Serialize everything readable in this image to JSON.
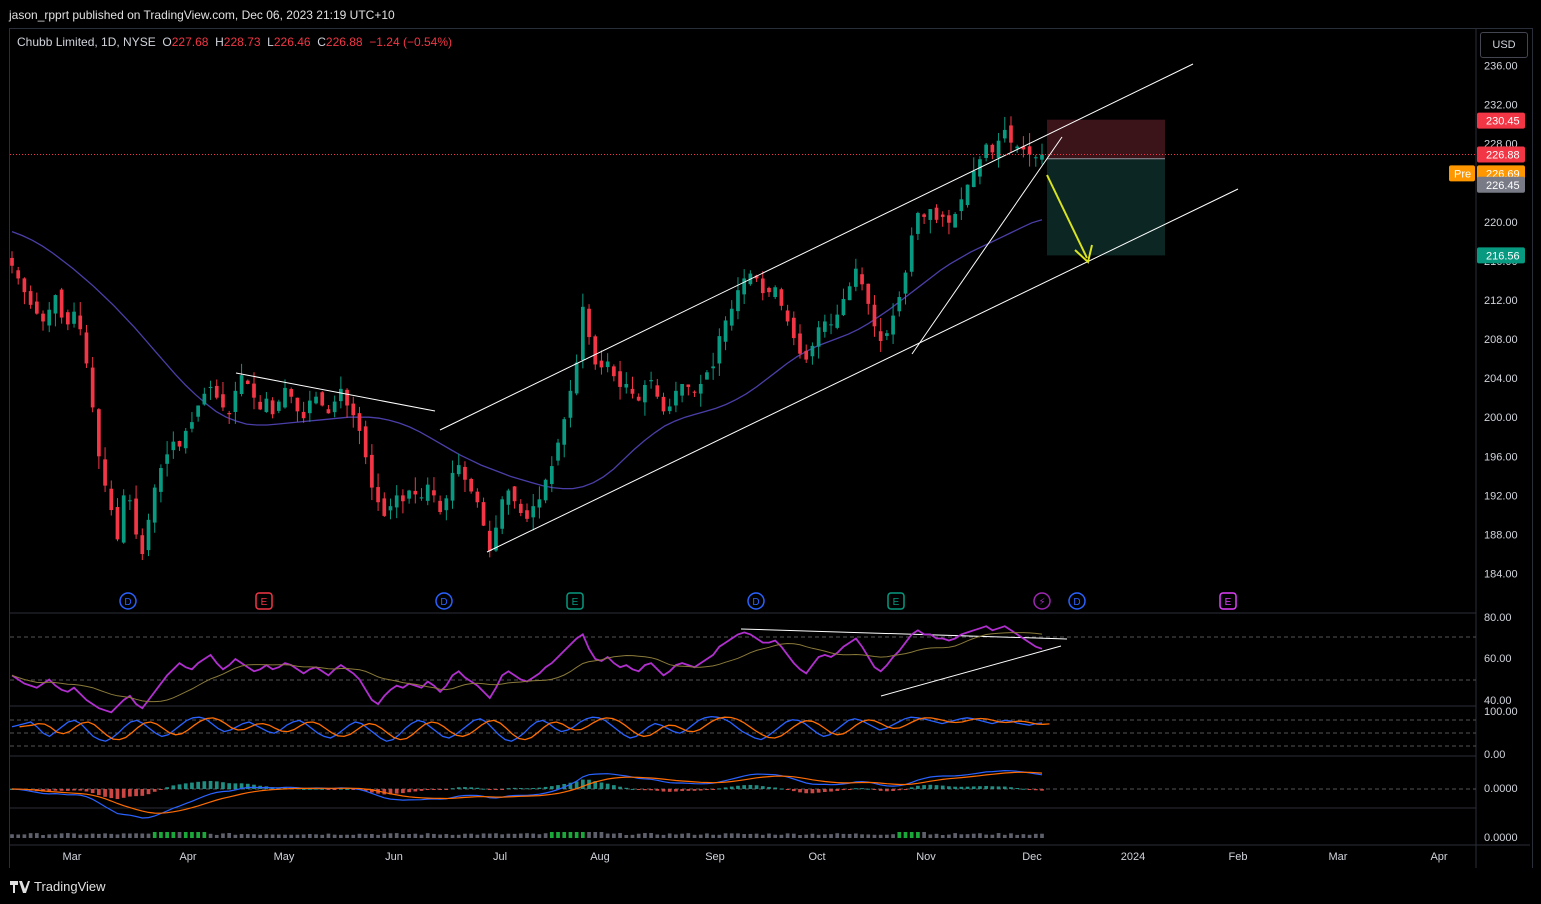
{
  "header": {
    "published_by": "jason_rpprt published on TradingView.com, Dec 06, 2023 21:19 UTC+10"
  },
  "legend": {
    "symbol": "Chubb Limited, 1D, NYSE",
    "open_label": "O",
    "open": "227.68",
    "high_label": "H",
    "high": "228.73",
    "low_label": "L",
    "low": "226.46",
    "close_label": "C",
    "close": "226.88",
    "change": "−1.24 (−0.54%)"
  },
  "currency_button": "USD",
  "footer": {
    "brand": "TradingView"
  },
  "colors": {
    "up": "#089981",
    "down": "#f23645",
    "ma": "#4a3fa8",
    "rsi": "#b12fcf",
    "stoch_k": "#2962ff",
    "stoch_d": "#ff6d00",
    "arrow": "#d9e321",
    "stop_zone": "#3a1419",
    "target_zone": "#0b2623"
  },
  "chart_data": {
    "type": "candlestick",
    "xlabels": [
      "Mar",
      "Apr",
      "May",
      "Jun",
      "Jul",
      "Aug",
      "Sep",
      "Oct",
      "Nov",
      "Dec",
      "2024",
      "Feb",
      "Mar",
      "Apr"
    ],
    "price_axis": {
      "ylim": [
        181.5,
        238.5
      ],
      "ticks": [
        "236.00",
        "232.00",
        "228.00",
        "224.00",
        "220.00",
        "216.00",
        "212.00",
        "208.00",
        "204.00",
        "200.00",
        "196.00",
        "192.00",
        "188.00",
        "184.00"
      ]
    },
    "price_labels": [
      {
        "value": 230.45,
        "text": "230.45",
        "bg": "#f23645"
      },
      {
        "value": 226.88,
        "text": "226.88",
        "bg": "#f23645"
      },
      {
        "value": 226.69,
        "text": "226.69",
        "bg": "#ff9800",
        "tag": "Pre"
      },
      {
        "value": 226.45,
        "text": "226.45",
        "bg": "#787b86"
      },
      {
        "value": 216.56,
        "text": "216.56",
        "bg": "#089981"
      }
    ],
    "last_price": 226.88,
    "position": {
      "entry": 226.45,
      "stop": 230.45,
      "target": 216.56
    },
    "events": [
      {
        "letter": "D",
        "color": "#2962ff"
      },
      {
        "letter": "E",
        "color": "#f23645"
      },
      {
        "letter": "D",
        "color": "#2962ff"
      },
      {
        "letter": "E",
        "color": "#089981"
      },
      {
        "letter": "D",
        "color": "#2962ff"
      },
      {
        "letter": "E",
        "color": "#089981"
      },
      {
        "letter": "⚡",
        "color": "#9c27b0"
      },
      {
        "letter": "D",
        "color": "#2962ff"
      },
      {
        "letter": "E",
        "color": "#e040fb"
      }
    ],
    "rsi_ticks": [
      "80.00",
      "60.00",
      "40.00"
    ],
    "stoch_ticks": [
      "100.00",
      "0.00"
    ],
    "macd_ticks": [
      "0.0000"
    ],
    "vol_ticks": [
      "0.0000"
    ],
    "closes": [
      215.5,
      214.2,
      212.8,
      211.5,
      210.6,
      209.8,
      211.0,
      212.5,
      210.2,
      209.5,
      210.8,
      209.0,
      205.5,
      201.0,
      196.0,
      193.0,
      190.5,
      187.5,
      192.0,
      191.5,
      188.0,
      186.0,
      189.5,
      192.8,
      194.8,
      196.2,
      197.5,
      197.0,
      198.6,
      199.5,
      201.2,
      202.4,
      203.1,
      202.0,
      201.0,
      200.3,
      202.7,
      204.3,
      203.4,
      202.0,
      200.8,
      201.9,
      200.3,
      201.6,
      203.0,
      202.1,
      200.6,
      199.9,
      201.7,
      202.1,
      201.2,
      200.4,
      201.6,
      202.9,
      201.2,
      200.2,
      198.6,
      195.9,
      192.8,
      191.3,
      189.9,
      190.9,
      192.0,
      191.4,
      192.5,
      192.1,
      191.8,
      193.1,
      192.0,
      190.3,
      191.7,
      194.3,
      195.1,
      193.6,
      192.4,
      191.3,
      188.9,
      186.3,
      188.7,
      191.6,
      192.5,
      191.4,
      190.2,
      189.6,
      190.9,
      191.6,
      193.6,
      195.0,
      197.4,
      199.8,
      202.7,
      205.6,
      211.3,
      208.2,
      205.4,
      205.1,
      205.7,
      204.2,
      203.1,
      203.4,
      202.4,
      201.7,
      203.3,
      203.8,
      202.1,
      200.6,
      201.1,
      202.7,
      203.4,
      203.1,
      202.5,
      203.4,
      204.6,
      205.2,
      208.3,
      209.9,
      211.1,
      213.0,
      214.2,
      214.7,
      214.2,
      212.7,
      212.8,
      213.3,
      211.4,
      209.8,
      208.1,
      206.5,
      205.9,
      207.3,
      209.2,
      209.8,
      209.5,
      210.5,
      212.1,
      213.4,
      215.2,
      213.6,
      211.6,
      209.3,
      207.8,
      208.6,
      210.4,
      212.3,
      214.8,
      218.6,
      220.9,
      220.5,
      221.3,
      220.2,
      220.5,
      219.9,
      220.8,
      222.3,
      223.8,
      225.2,
      226.4,
      227.9,
      227.1,
      228.3,
      229.4,
      228.1,
      227.7,
      227.4,
      226.9,
      226.6,
      226.88
    ],
    "ma": [
      219.0,
      218.6,
      218.1,
      217.5,
      216.8,
      216.0,
      215.2,
      214.3,
      213.4,
      212.4,
      211.4,
      210.3,
      209.2,
      208.0,
      206.8,
      205.6,
      204.4,
      203.3,
      202.3,
      201.4,
      200.6,
      200.0,
      199.6,
      199.3,
      199.2,
      199.2,
      199.3,
      199.4,
      199.5,
      199.6,
      199.7,
      199.8,
      199.9,
      200.0,
      200.0,
      200.0,
      199.9,
      199.7,
      199.4,
      199.0,
      198.5,
      197.9,
      197.3,
      196.7,
      196.1,
      195.6,
      195.1,
      194.7,
      194.3,
      193.9,
      193.6,
      193.3,
      193.0,
      192.8,
      192.7,
      192.7,
      192.9,
      193.3,
      193.9,
      194.7,
      195.7,
      196.7,
      197.6,
      198.4,
      199.1,
      199.6,
      200.0,
      200.3,
      200.6,
      200.9,
      201.3,
      201.8,
      202.4,
      203.1,
      203.9,
      204.7,
      205.5,
      206.2,
      206.8,
      207.3,
      207.7,
      208.1,
      208.5,
      209.0,
      209.6,
      210.3,
      211.0,
      211.8,
      212.6,
      213.4,
      214.2,
      215.0,
      215.7,
      216.3,
      216.9,
      217.4,
      217.9,
      218.4,
      218.9,
      219.4,
      219.9,
      220.2
    ],
    "rsi": [
      52,
      50,
      48,
      47,
      46,
      48,
      50,
      47,
      45,
      44,
      46,
      43,
      40,
      38,
      36,
      35,
      34,
      37,
      40,
      42,
      38,
      36,
      40,
      44,
      48,
      52,
      55,
      58,
      56,
      55,
      58,
      60,
      62,
      58,
      55,
      57,
      60,
      58,
      56,
      54,
      55,
      57,
      55,
      56,
      58,
      57,
      55,
      53,
      55,
      56,
      54,
      52,
      55,
      57,
      55,
      53,
      50,
      45,
      40,
      38,
      42,
      45,
      47,
      46,
      48,
      47,
      46,
      49,
      47,
      44,
      47,
      52,
      54,
      51,
      49,
      47,
      44,
      41,
      46,
      52,
      54,
      52,
      50,
      49,
      51,
      53,
      56,
      58,
      61,
      64,
      67,
      70,
      72,
      65,
      60,
      59,
      61,
      58,
      56,
      57,
      55,
      54,
      57,
      58,
      55,
      52,
      54,
      57,
      58,
      57,
      56,
      58,
      60,
      62,
      66,
      68,
      70,
      72,
      73,
      72,
      70,
      68,
      68,
      69,
      66,
      62,
      58,
      55,
      53,
      57,
      61,
      62,
      61,
      63,
      66,
      68,
      70,
      66,
      61,
      56,
      54,
      57,
      61,
      64,
      68,
      72,
      74,
      72,
      72,
      70,
      70,
      69,
      70,
      72,
      73,
      74,
      75,
      76,
      74,
      75,
      76,
      74,
      72,
      70,
      68,
      66,
      65
    ],
    "stoch": [
      60,
      65,
      70,
      75,
      60,
      40,
      30,
      45,
      60,
      75,
      80,
      70,
      50,
      30,
      20,
      15,
      25,
      40,
      60,
      75,
      80,
      70,
      55,
      40,
      30,
      35,
      50,
      65,
      80,
      88,
      90,
      85,
      70,
      55,
      45,
      50,
      60,
      70,
      75,
      65,
      55,
      45,
      40,
      50,
      65,
      75,
      80,
      70,
      55,
      40,
      30,
      25,
      35,
      50,
      65,
      75,
      70,
      55,
      40,
      25,
      15,
      20,
      35,
      55,
      70,
      80,
      75,
      60,
      45,
      30,
      25,
      35,
      50,
      65,
      80,
      85,
      75,
      55,
      35,
      20,
      15,
      25,
      40,
      60,
      75,
      80,
      70,
      55,
      45,
      50,
      60,
      75,
      85,
      90,
      88,
      80,
      65,
      50,
      35,
      25,
      30,
      45,
      60,
      70,
      65,
      55,
      45,
      40,
      50,
      65,
      80,
      88,
      92,
      90,
      85,
      75,
      60,
      45,
      35,
      25,
      20,
      30,
      45,
      60,
      75,
      82,
      80,
      70,
      55,
      40,
      30,
      35,
      50,
      65,
      80,
      85,
      80,
      70,
      60,
      50,
      55,
      65,
      75,
      85,
      90,
      88,
      85,
      80,
      75,
      70,
      75,
      80,
      85,
      88,
      85,
      80,
      75,
      70,
      75,
      80,
      78,
      72,
      68,
      65,
      70,
      72
    ]
  }
}
